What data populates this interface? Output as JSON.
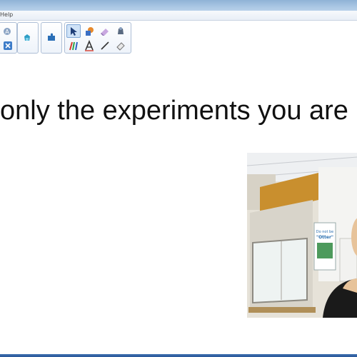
{
  "menubar": {
    "help_label": "Help"
  },
  "toolbar": {
    "groups": [
      {
        "name": "file-group",
        "icons": [
          "text-recognition-icon",
          "close-icon"
        ]
      },
      {
        "name": "page-group",
        "icons": [
          "pen-tray-icon"
        ]
      },
      {
        "name": "puzzle-group",
        "icons": [
          "puzzle-icon"
        ]
      },
      {
        "name": "tools-group",
        "icons": [
          "select-arrow-icon",
          "shapes-icon",
          "eraser-icon",
          "fill-icon",
          "creative-pens-icon",
          "text-icon",
          "line-icon",
          "eraser-tool-icon"
        ]
      }
    ]
  },
  "slide": {
    "text": "only the experiments you are"
  },
  "webcam": {
    "poster_line1": "Do not be",
    "poster_line2": "\"Otter\"",
    "colors": {
      "wall": "#e6e2d8",
      "orange_wall": "#c98f2e",
      "hood": "#d8d4ca",
      "shirt": "#1a1a1a",
      "skin": "#e7c39a"
    }
  },
  "colors": {
    "titlebar": "#9dbde0",
    "taskbar": "#3563a6",
    "active_tool": "#cfe2f7"
  }
}
